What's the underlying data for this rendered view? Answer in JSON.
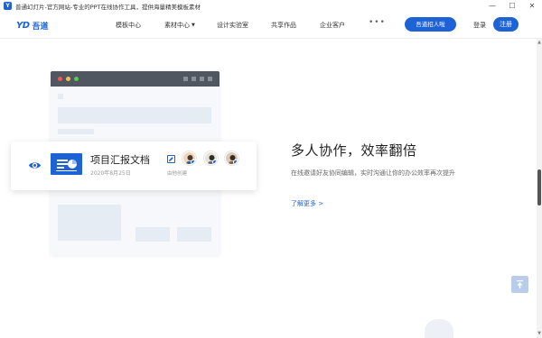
{
  "window": {
    "title": "普通幻灯片-官方网站-专业的PPT在线协作工具，提供海量精美模板素材",
    "min_glyph": "—",
    "max_glyph": "☐",
    "close_glyph": "✕"
  },
  "header": {
    "logo_mark": "YD",
    "logo_name": "吾道",
    "nav": {
      "templates": "模板中心",
      "assets": "素材中心",
      "assets_caret": "▼",
      "lab": "设计实验室",
      "works": "共享作品",
      "enterprise": "企业客户",
      "more": "•••"
    },
    "hire_button": "吾道招人啦",
    "login": "登录",
    "register": "注册"
  },
  "doc_card": {
    "title": "项目汇报文档",
    "date": "2020年8月25日",
    "edit_label": "由他创建"
  },
  "feature": {
    "title": "多人协作，效率翻倍",
    "description": "在线邀请好友协同编辑，实时沟通让你的办公效率再次提升",
    "learn_more": "了解更多 >"
  },
  "colors": {
    "accent": "#1e63d6",
    "titlebar_dark": "#505761"
  },
  "icons": {
    "eye": "eye-icon",
    "edit": "edit-icon",
    "back_to_top": "arrow-up-icon"
  }
}
